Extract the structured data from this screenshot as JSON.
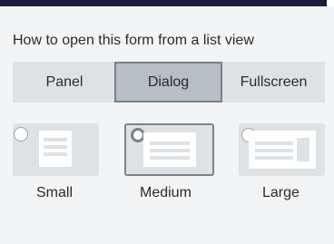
{
  "section": {
    "heading": "How to open this form from a list view"
  },
  "open_mode": {
    "options": [
      "Panel",
      "Dialog",
      "Fullscreen"
    ],
    "selected": "Dialog"
  },
  "size": {
    "options": [
      "Small",
      "Medium",
      "Large"
    ],
    "selected": "Medium"
  },
  "icons": {
    "small": "form-small-preview-icon",
    "medium": "form-medium-preview-icon",
    "large": "form-large-preview-icon"
  }
}
